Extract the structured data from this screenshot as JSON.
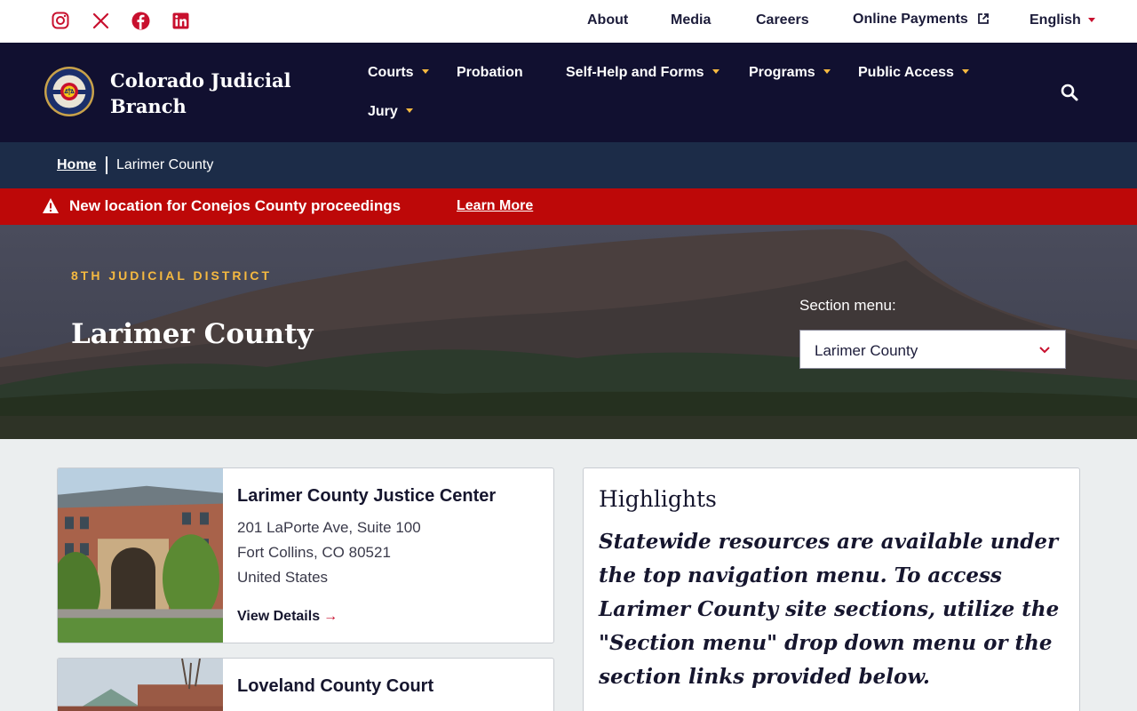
{
  "social": {
    "icons": [
      "instagram-icon",
      "x-icon",
      "facebook-icon",
      "linkedin-icon"
    ],
    "color": "#c8102e"
  },
  "utility": {
    "about": "About",
    "media": "Media",
    "careers": "Careers",
    "online_payments": "Online Payments",
    "language": "English"
  },
  "brand": {
    "name": "Colorado Judicial Branch",
    "seal_text_top": "COLORADO",
    "seal_text_bottom": "COURTS"
  },
  "nav": {
    "courts": "Courts",
    "probation": "Probation",
    "self_help": "Self-Help and Forms",
    "programs": "Programs",
    "public_access": "Public Access",
    "jury": "Jury"
  },
  "breadcrumb": {
    "home": "Home",
    "current": "Larimer County"
  },
  "alert": {
    "text": "New location for Conejos County proceedings",
    "link": "Learn More"
  },
  "hero": {
    "eyebrow": "8TH JUDICIAL DISTRICT",
    "title": "Larimer County",
    "section_label": "Section menu:",
    "section_value": "Larimer County"
  },
  "cards": [
    {
      "title": "Larimer County Justice Center",
      "address_line1": "201 LaPorte Ave, Suite 100",
      "address_line2": "Fort Collins, CO 80521",
      "address_line3": "United States",
      "link": "View Details"
    },
    {
      "title": "Loveland County Court"
    }
  ],
  "highlights": {
    "title": "Highlights",
    "body": "Statewide resources are available under the top navigation menu. To access Larimer County site sections, utilize the \"Section menu\" drop down menu or the section links provided below."
  },
  "colors": {
    "navy": "#111030",
    "breadcrumb": "#1c2c48",
    "alert": "#bd0808",
    "gold": "#f5b940",
    "red_accent": "#c8102e"
  }
}
